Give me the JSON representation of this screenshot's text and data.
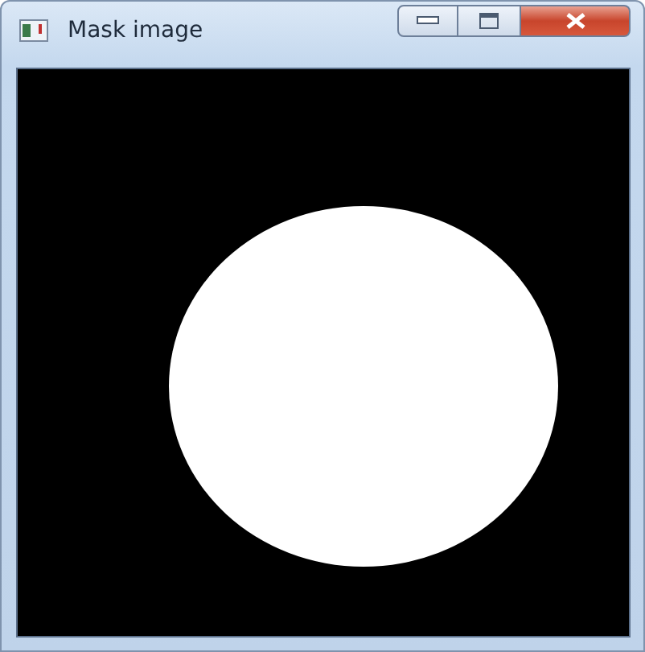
{
  "window": {
    "title": "Mask image"
  }
}
